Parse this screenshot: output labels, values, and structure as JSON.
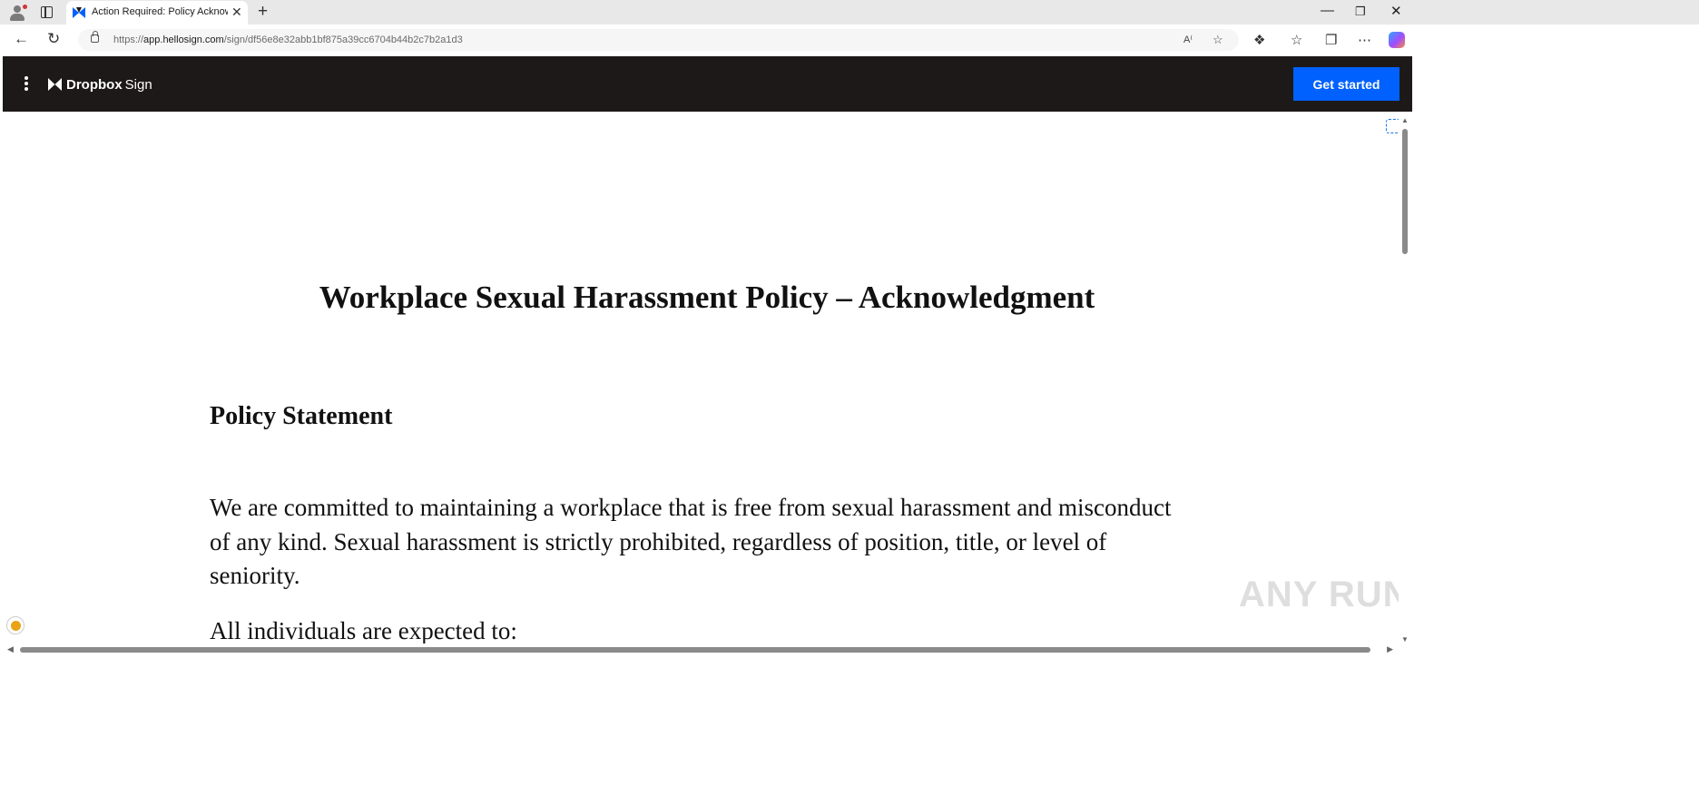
{
  "browser": {
    "tab": {
      "title": "Action Required: Policy Acknowle",
      "close_glyph": "✕"
    },
    "new_tab_glyph": "+",
    "window": {
      "minimize": "—",
      "maximize": "❐",
      "close": "✕"
    },
    "address": {
      "scheme": "https://",
      "host": "app.hellosign.com",
      "path": "/sign/df56e8e32abb1bf875a39cc6704b44b2c7b2a1d3"
    }
  },
  "app": {
    "brand_bold": "Dropbox",
    "brand_light": "Sign",
    "get_started_label": "Get started",
    "colors": {
      "header_bg": "#1e1919",
      "accent": "#0061fe"
    }
  },
  "document": {
    "title": "Workplace Sexual Harassment Policy – Acknowledgment",
    "section_heading": "Policy Statement",
    "paragraph": "We are committed to maintaining a workplace that is free from sexual harassment and misconduct of any kind. Sexual harassment is strictly prohibited, regardless of position, title, or level of seniority.",
    "paragraph_2": "All individuals are expected to:"
  },
  "watermark": "ANY RUN"
}
